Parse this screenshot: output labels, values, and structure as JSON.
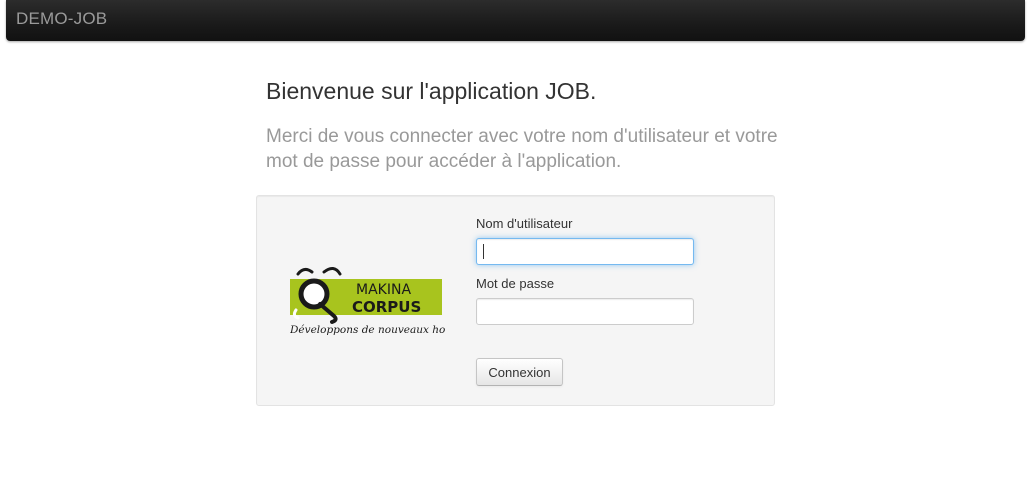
{
  "navbar": {
    "brand": "DEMO-JOB"
  },
  "main": {
    "title": "Bienvenue sur l'application JOB.",
    "lead": "Merci de vous connecter avec votre nom d'utilisateur et votre mot de passe pour accéder à l'application."
  },
  "login": {
    "logo": {
      "line1": "MAKINA",
      "line2": "CORPUS",
      "tagline": "Développons de nouveaux horizons",
      "color": "#a8c41e"
    },
    "username_label": "Nom d'utilisateur",
    "username_value": "",
    "password_label": "Mot de passe",
    "password_value": "",
    "submit_label": "Connexion"
  },
  "colors": {
    "navbar": "#1b1b1b",
    "brand_text": "#9a9a9a",
    "focus": "#52a8ec"
  }
}
